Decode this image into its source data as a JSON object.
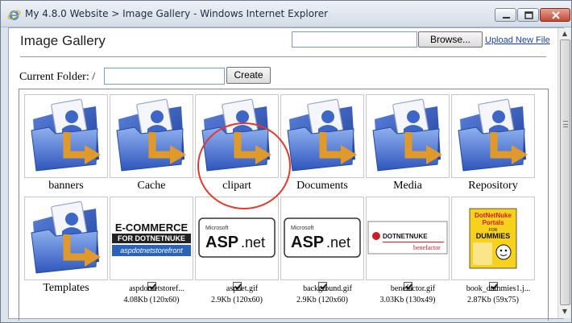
{
  "window": {
    "title": "My 4.8.0 Website > Image Gallery - Windows Internet Explorer"
  },
  "header": {
    "title": "Image Gallery",
    "browse_label": "Browse...",
    "upload_link": "Upload New File"
  },
  "toolbar": {
    "current_folder_label": "Current Folder: /",
    "folder_input_value": "",
    "create_label": "Create"
  },
  "folders": [
    {
      "label": "banners"
    },
    {
      "label": "Cache"
    },
    {
      "label": "clipart"
    },
    {
      "label": "Documents"
    },
    {
      "label": "Media"
    },
    {
      "label": "Repository"
    },
    {
      "label": "Templates"
    }
  ],
  "files": [
    {
      "name": "aspdotnetstoref...",
      "size": "4.08Kb",
      "dims": "(120x60)",
      "meta": "4.08Kb (120x60)",
      "preview": "E-COMMERCE FOR DOTNETNUKE storefront"
    },
    {
      "name": "aspnet.gif",
      "size": "2.9Kb",
      "dims": "(120x60)",
      "meta": "2.9Kb (120x60)",
      "preview": "ASP.net"
    },
    {
      "name": "background.gif",
      "size": "2.9Kb",
      "dims": "(120x60)",
      "meta": "2.9Kb (120x60)",
      "preview": "ASP.net"
    },
    {
      "name": "benefactor.gif",
      "size": "3.03Kb",
      "dims": "(130x49)",
      "meta": "3.03Kb (130x49)",
      "preview": "DOTNETNUKE benefactor"
    },
    {
      "name": "book_dummies1.j...",
      "size": "2.87Kb",
      "dims": "(59x75)",
      "meta": "2.87Kb (59x75)",
      "preview": "DotNetNuke Portals for DUMMIES"
    }
  ],
  "previews": {
    "ecommerce_line1": "E-COMMERCE",
    "ecommerce_line2": "FOR DOTNETNUKE",
    "ecommerce_line3": "aspdotnetstorefront",
    "microsoft": "Microsoft",
    "asp": "ASP",
    "net": ".net",
    "dnn": "DOTNETNUKE",
    "benefactor": "benefactor",
    "book_line1": "DotNetNuke",
    "book_line2": "Portals",
    "book_for": "FOR",
    "book_dummies": "DUMMIES"
  },
  "colors": {
    "folder_blue": "#3f67c8",
    "arrow_orange": "#e09a2c",
    "highlight": "#e03a2e",
    "link": "#1a3fb5"
  },
  "icons": {
    "folder": "folder-arrow-icon",
    "window": "ie-logo-icon"
  }
}
